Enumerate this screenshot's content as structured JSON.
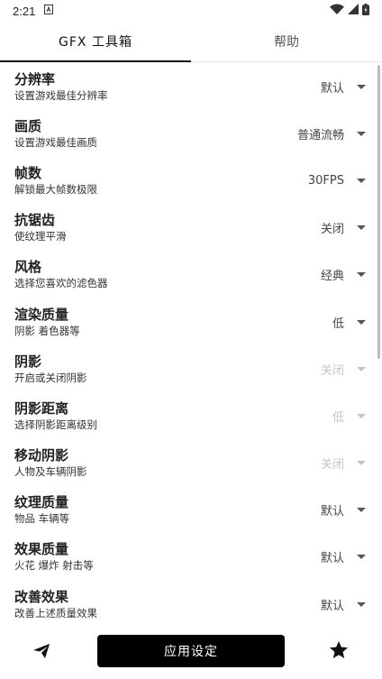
{
  "status": {
    "time": "2:21"
  },
  "tabs": [
    {
      "label": "GFX 工具箱"
    },
    {
      "label": "帮助"
    }
  ],
  "settings": [
    {
      "title": "分辨率",
      "subtitle": "设置游戏最佳分辨率",
      "value": "默认",
      "enabled": true
    },
    {
      "title": "画质",
      "subtitle": "设置游戏最佳画质",
      "value": "普通流畅",
      "enabled": true
    },
    {
      "title": "帧数",
      "subtitle": "解锁最大帧数极限",
      "value": "30FPS",
      "enabled": true
    },
    {
      "title": "抗锯齿",
      "subtitle": "使纹理平滑",
      "value": "关闭",
      "enabled": true
    },
    {
      "title": "风格",
      "subtitle": "选择您喜欢的滤色器",
      "value": "经典",
      "enabled": true
    },
    {
      "title": "渲染质量",
      "subtitle": "阴影 着色器等",
      "value": "低",
      "enabled": true
    },
    {
      "title": "阴影",
      "subtitle": "开启或关闭阴影",
      "value": "关闭",
      "enabled": false
    },
    {
      "title": "阴影距离",
      "subtitle": "选择阴影距离级别",
      "value": "低",
      "enabled": false
    },
    {
      "title": "移动阴影",
      "subtitle": "人物及车辆阴影",
      "value": "关闭",
      "enabled": false
    },
    {
      "title": "纹理质量",
      "subtitle": "物品 车辆等",
      "value": "默认",
      "enabled": true
    },
    {
      "title": "效果质量",
      "subtitle": "火花 爆炸 射击等",
      "value": "默认",
      "enabled": true
    },
    {
      "title": "改善效果",
      "subtitle": "改善上述质量效果",
      "value": "默认",
      "enabled": true
    }
  ],
  "bottom": {
    "apply_label": "应用设定",
    "send_icon": "send-icon",
    "star_icon": "star-icon"
  },
  "colors": {
    "primary": "#000000",
    "disabled": "#c4c4c4"
  }
}
